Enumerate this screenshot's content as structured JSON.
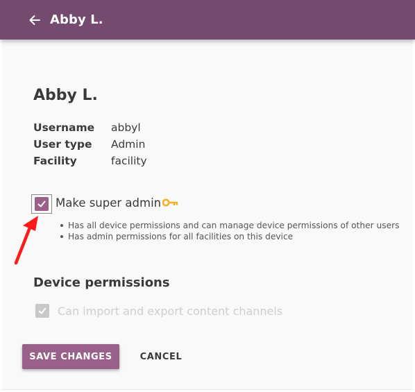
{
  "appbar": {
    "title": "Abby L.",
    "back_icon": "arrow-back-icon",
    "background": "#744a6e"
  },
  "user": {
    "name": "Abby L.",
    "details": [
      {
        "label": "Username",
        "value": "abbyl"
      },
      {
        "label": "User type",
        "value": "Admin"
      },
      {
        "label": "Facility",
        "value": "facility"
      }
    ]
  },
  "super_admin": {
    "label": "Make super admin",
    "checked": true,
    "icon": "key-icon",
    "icon_color": "#f0b429",
    "notes": [
      "Has all device permissions and can manage device permissions of other users",
      "Has admin permissions for all facilities on this device"
    ]
  },
  "device_permissions": {
    "title": "Device permissions",
    "items": [
      {
        "label": "Can import and export content channels",
        "checked": true,
        "disabled": true
      }
    ]
  },
  "actions": {
    "save_label": "SAVE CHANGES",
    "cancel_label": "CANCEL"
  },
  "annotation": {
    "icon": "red-arrow-pointer",
    "color": "#ff1a1a"
  },
  "colors": {
    "accent": "#996189",
    "text": "#3a3a3a",
    "disabled": "#cfcfcf"
  }
}
